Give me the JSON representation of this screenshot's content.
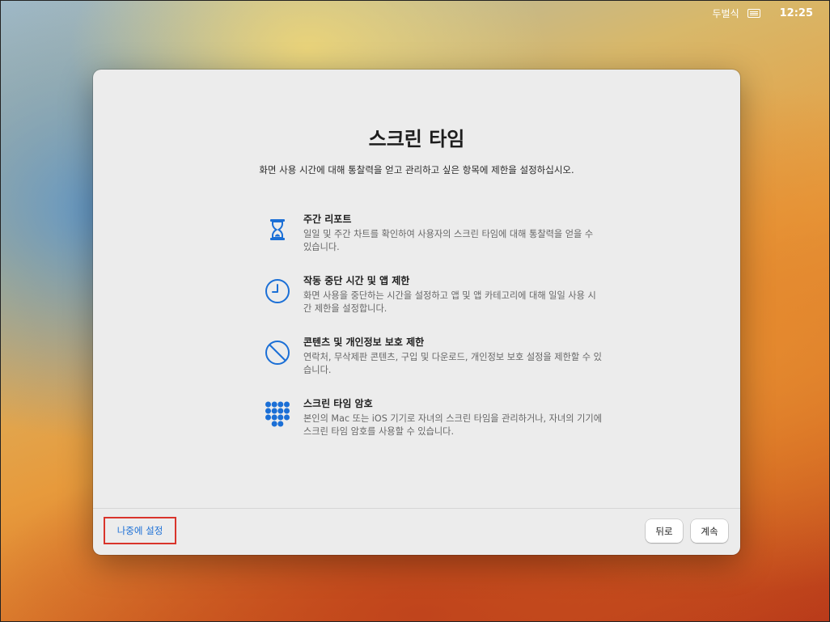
{
  "menubar": {
    "user": "두벌식",
    "time": "12:25"
  },
  "dialog": {
    "title": "스크린 타임",
    "subtitle": "화면 사용 시간에 대해 통찰력을 얻고 관리하고 싶은 항목에 제한을 설정하십시오.",
    "features": [
      {
        "icon": "hourglass-icon",
        "title": "주간 리포트",
        "description": "일일 및 주간 차트를 확인하여 사용자의 스크린 타임에 대해 통찰력을 얻을 수 있습니다."
      },
      {
        "icon": "clock-icon",
        "title": "작동 중단 시간 및 앱 제한",
        "description": "화면 사용을 중단하는 시간을 설정하고 앱 및 앱 카테고리에 대해 일일 사용 시간 제한을 설정합니다."
      },
      {
        "icon": "prohibited-icon",
        "title": "콘텐츠 및 개인정보 보호 제한",
        "description": "연락처, 무삭제판 콘텐츠, 구입 및 다운로드, 개인정보 보호 설정을 제한할 수 있습니다."
      },
      {
        "icon": "keypad-icon",
        "title": "스크린 타임 암호",
        "description": "본인의 Mac 또는 iOS 기기로 자녀의 스크린 타임을 관리하거나, 자녀의 기기에 스크린 타임 암호를 사용할 수 있습니다."
      }
    ],
    "buttons": {
      "later": "나중에 설정",
      "back": "뒤로",
      "continue": "계속"
    }
  },
  "colors": {
    "accent": "#1b6fd6",
    "highlight_border": "#d9342b"
  }
}
